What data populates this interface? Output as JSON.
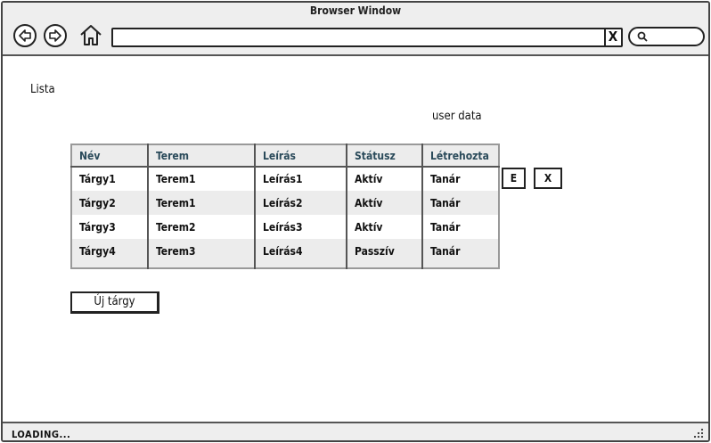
{
  "window": {
    "title": "Browser Window"
  },
  "toolbar": {
    "back_icon": "left-arrow-icon",
    "forward_icon": "right-arrow-icon",
    "home_icon": "home-icon",
    "address_value": "",
    "clear_label": "X",
    "search_icon": "search-icon"
  },
  "page": {
    "heading": "Lista",
    "user_data": "user data",
    "table": {
      "headers": [
        "Név",
        "Terem",
        "Leírás",
        "Státusz",
        "Létrehozta"
      ],
      "rows": [
        [
          "Tárgy1",
          "Terem1",
          "Leírás1",
          "Aktív",
          "Tanár"
        ],
        [
          "Tárgy2",
          "Terem1",
          "Leírás2",
          "Aktív",
          "Tanár"
        ],
        [
          "Tárgy3",
          "Terem2",
          "Leírás3",
          "Aktív",
          "Tanár"
        ],
        [
          "Tárgy4",
          "Terem3",
          "Leírás4",
          "Passzív",
          "Tanár"
        ]
      ]
    },
    "edit_label": "E",
    "delete_label": "X",
    "new_label": "Új tárgy"
  },
  "status": {
    "text": "LOADING..."
  },
  "colors": {
    "header_text": "#2a4a5a",
    "chrome_bg": "#eeeeee",
    "alt_row_bg": "#ececec"
  }
}
